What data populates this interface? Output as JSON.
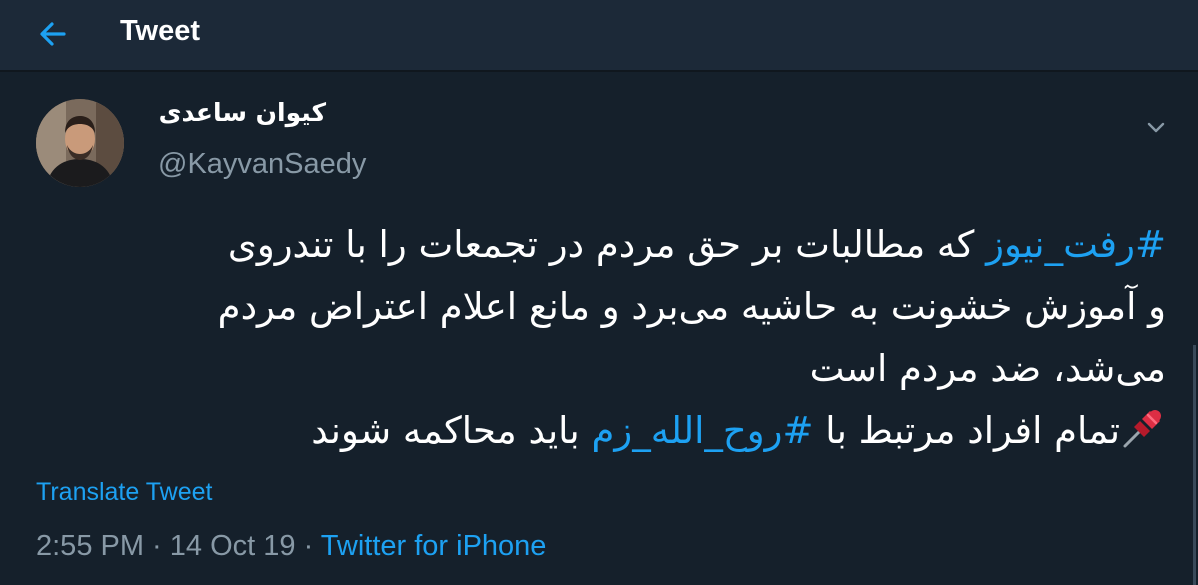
{
  "header": {
    "title": "Tweet",
    "back_icon": "arrow-left-icon"
  },
  "author": {
    "display_name": "کیوان ساعدی",
    "handle": "@KayvanSaedy"
  },
  "tweet": {
    "line1_hashtag": "#رفت_نیوز",
    "line1_text": " که مطالبات بر حق مردم در تجمعات را با تندروی",
    "line2_text": "و آموزش خشونت به حاشیه می‌برد و مانع اعلام اعتراض مردم",
    "line3_text": "می‌شد، ضد مردم است",
    "line4_emoji": "pushpin-icon",
    "line4_before": "تمام افراد مرتبط با ",
    "line4_hashtag": "#روح_الله_زم",
    "line4_after": " باید محاکمه شوند"
  },
  "translate_label": "Translate Tweet",
  "meta": {
    "time": "2:55 PM",
    "separator1": " · ",
    "date": "14 Oct 19",
    "separator2": " · ",
    "source": "Twitter for iPhone"
  },
  "colors": {
    "background": "#15202b",
    "header_bg": "#1c2938",
    "accent": "#1da1f2",
    "secondary_text": "#8899a6"
  }
}
